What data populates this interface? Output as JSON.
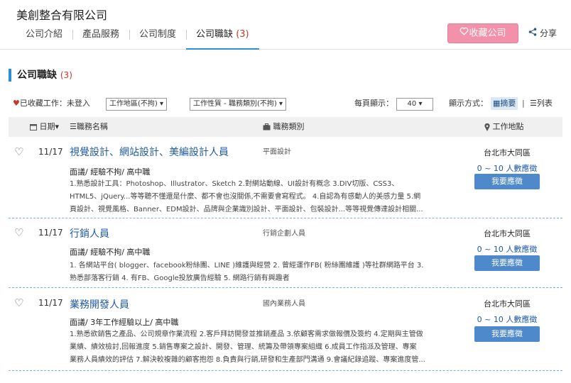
{
  "company": {
    "name": "美創整合有限公司"
  },
  "tabs": [
    {
      "label": "公司介紹"
    },
    {
      "label": "產品服務"
    },
    {
      "label": "公司制度"
    },
    {
      "label": "公司職缺",
      "count": "(3)"
    }
  ],
  "actions": {
    "favorite_label": "收藏公司",
    "share_label": "分享"
  },
  "section": {
    "title": "公司職缺",
    "count": "(3)"
  },
  "filters": {
    "saved_label": "已收藏工作：未登入",
    "area_select": "工作地區(不拘)",
    "category_select": "工作性質 - 職務類別(不拘)",
    "per_page_label": "每頁顯示：",
    "per_page_value": "40",
    "display_label": "顯示方式：",
    "view_summary": "摘要",
    "view_separator": "|",
    "view_list": "列表"
  },
  "table_header": {
    "date": "日期",
    "job_name": "職務名稱",
    "job_category": "職務類別",
    "location": "工作地點"
  },
  "jobs": [
    {
      "date": "11/17",
      "title": "視覺設計、網站設計、美編設計人員",
      "category": "平面設計",
      "requirements": "面議/ 經驗不拘/ 高中職",
      "desc_lines": [
        "1.熟悉設計工具：Photoshop、Illustrator、Sketch 2.對網站動線、UI設計有概念 3.DIV切版、CSS3、",
        "HTML5、jQuery...等等聽不懂還是什麼、都不會也沒關係,不需要會寫程式。 4.自認為有感動人的美感力量 5.網",
        "頁設計、視覺風格、Banner、EDM設計、品牌與企業識別設計、平面設計、包裝設計...等等視覺傳達設計相關..."
      ],
      "location": "台北市大同區",
      "applicants": "0 ~ 10 人數應徵",
      "apply_label": "我要應徵"
    },
    {
      "date": "11/17",
      "title": "行銷人員",
      "category": "行銷企劃人員",
      "requirements": "面議/ 經驗不拘/ 高中職",
      "desc_lines": [
        "1. 各網站平台( blogger、facebook粉絲團、LINE )維護與經營 2. 曾經運作FB( 粉絲團維護 )等社群網路平台 3.",
        "熟悉部落客行銷 4. 有FB、Google投放廣告經驗 5. 網路行銷有興趣者"
      ],
      "location": "台北市大同區",
      "applicants": "0 ~ 10 人數應徵",
      "apply_label": "我要應徵"
    },
    {
      "date": "11/17",
      "title": "業務開發人員",
      "category": "國內業務人員",
      "requirements": "面議/ 3年工作經驗以上/ 高中職",
      "desc_lines": [
        "1.熟悉欲銷售之產品、公司規章作業流程 2.客戶拜訪開發並推銷產品 3.依顧客需求做報價及簽約 4.定期與主管做",
        "業績、績效檢討,回報進度 5.銷售專案之設計、開發、管理、統籌及帶領專案組織 6.成員工作指派及管理、專案",
        "業務人員績效的評估 7.解決較複雜的顧客抱怨 8.負責與行銷,研發和生產部門溝通 9.會議紀錄追蹤、專案進度管..."
      ],
      "location": "台北市大同區",
      "applicants": "0 ~ 10 人數應徵",
      "apply_label": "我要應徵"
    }
  ]
}
